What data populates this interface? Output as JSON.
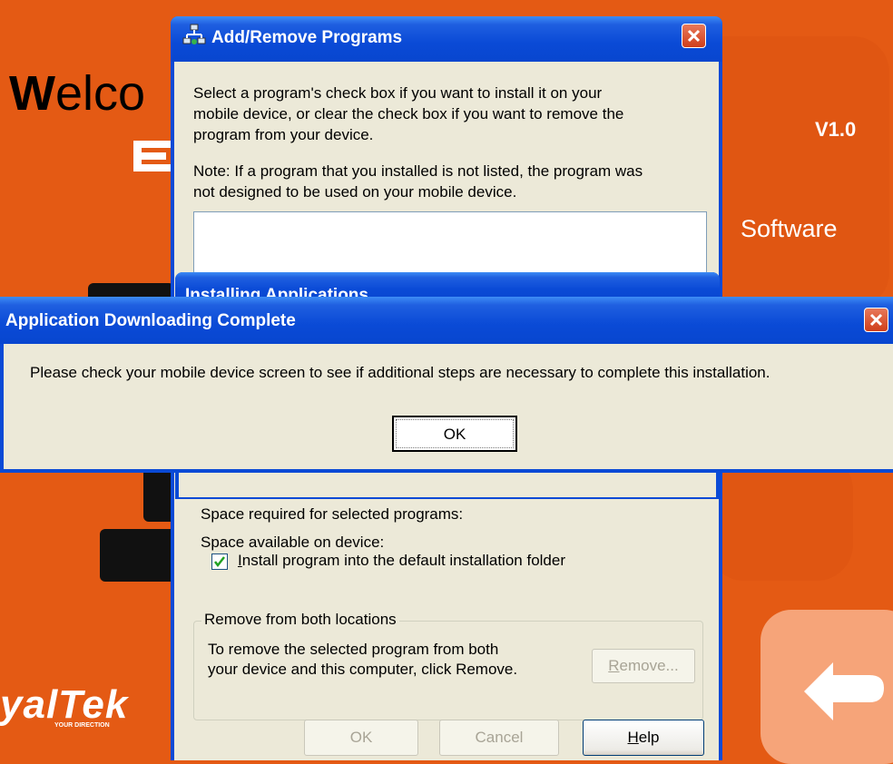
{
  "background_app": {
    "welcome_prefix": "W",
    "welcome_rest": "elco",
    "version": "V1.0",
    "software": "Software",
    "logo": "yalTek",
    "tagline": "YOUR DIRECTION"
  },
  "add_remove": {
    "title": "Add/Remove Programs",
    "instructions": [
      "Select a program's check box if you want to install it on your",
      "mobile device, or clear the check box if you want to remove the",
      "program from your device."
    ],
    "note": [
      "Note:  If a program that you installed is not listed, the program was",
      "not designed to be used on your mobile device."
    ],
    "space_required_label": "Space required for selected programs:",
    "space_available_label": "Space available on device:",
    "install_default_checkbox": {
      "label": "Install program into the default installation folder",
      "checked": true
    },
    "remove_group": {
      "legend": "Remove from both locations",
      "text": [
        "To remove the selected program from both",
        "your device and this computer, click Remove."
      ],
      "remove_button": "Remove..."
    },
    "buttons": {
      "ok": "OK",
      "cancel": "Cancel",
      "help": "Help"
    }
  },
  "installing_dialog": {
    "title": "Installing Applications"
  },
  "complete_dialog": {
    "title": "Application Downloading Complete",
    "message": "Please check your mobile device screen to see if additional steps are necessary to complete this installation.",
    "ok_button": "OK"
  },
  "colors": {
    "background": "#e45a14",
    "titlebar": "#0a4ad6",
    "dialog_face": "#ece9d8",
    "close_button": "#d5502f"
  },
  "icons": [
    "programs-icon",
    "close-icon",
    "checkmark-icon",
    "back-arrow-icon"
  ]
}
